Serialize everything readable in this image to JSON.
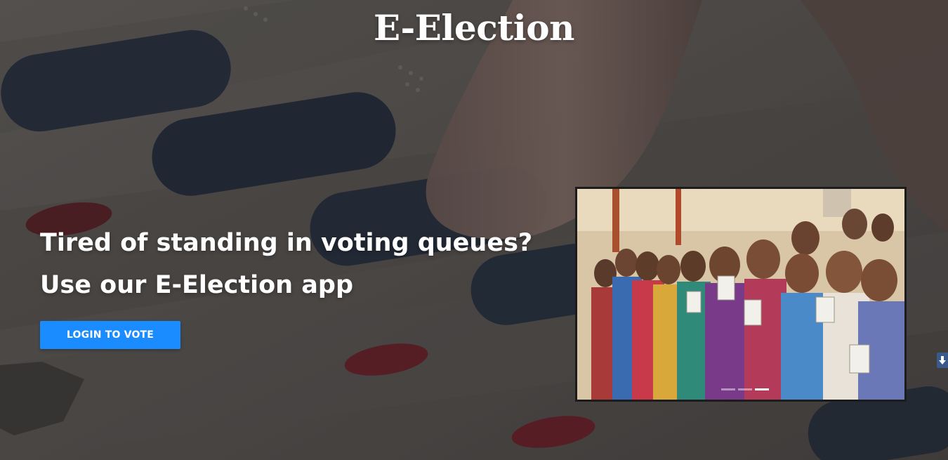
{
  "header": {
    "brand": "E-Election"
  },
  "hero": {
    "headline_line1": "Tired of standing in voting queues?",
    "headline_line2": "Use our E-Election app",
    "login_button": "LOGIN TO VOTE"
  },
  "carousel": {
    "slide_count": 3,
    "active_index": 2,
    "image_subject": "voters-holding-id-cards"
  },
  "colors": {
    "accent": "#1a8cff",
    "text": "#ffffff",
    "overlay": "#3c3a3b"
  },
  "icons": {
    "scroll_widget": "arrow-down-icon"
  }
}
